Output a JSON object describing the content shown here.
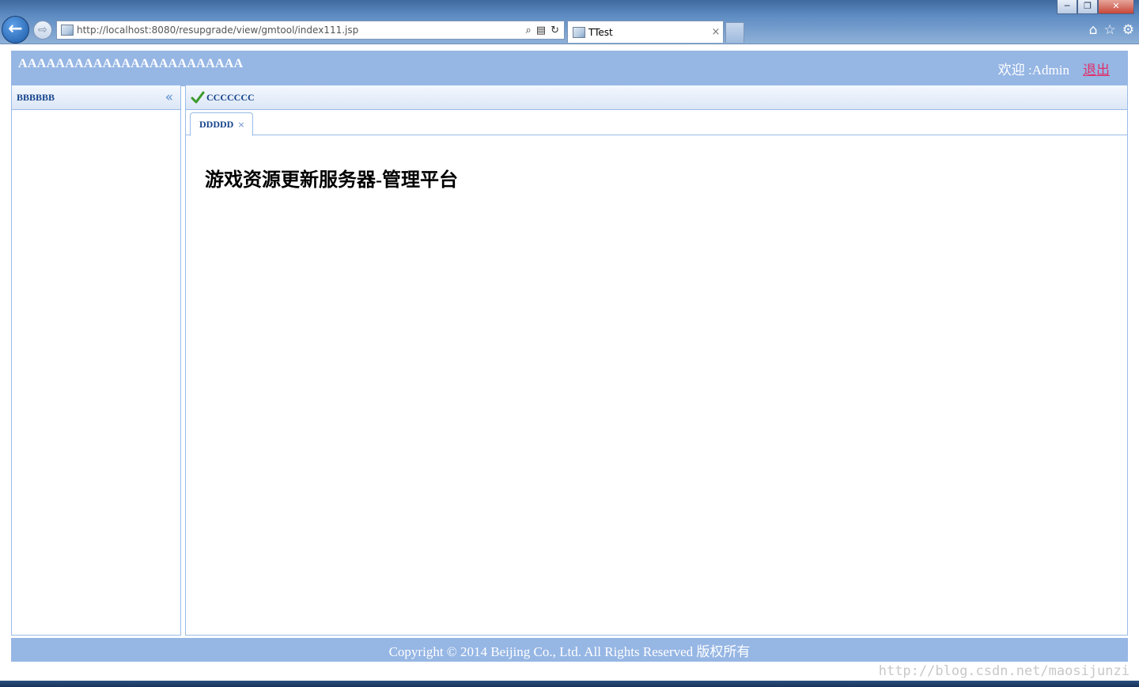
{
  "browser": {
    "url": "http://localhost:8080/resupgrade/view/gmtool/index111.jsp",
    "tab_title": "TTest",
    "tab_close": "×",
    "back_icon": "arrow-left-icon",
    "forward_icon": "arrow-right-icon",
    "window_buttons": {
      "minimize": "─",
      "restore": "❐",
      "close": "✕"
    },
    "address_tools": {
      "search": "⌕",
      "compat": "▤",
      "refresh": "↻"
    },
    "right_tools": {
      "home": "⌂",
      "favorites": "☆",
      "settings": "⚙"
    }
  },
  "header": {
    "title": "AAAAAAAAAAAAAAAAAAAAAAAA",
    "welcome": "欢迎 :Admin",
    "logout": "退出"
  },
  "left_panel": {
    "title": "BBBBBB",
    "collapse_glyph": "«"
  },
  "right_panel": {
    "title": "CCCCCCC",
    "tabs": [
      {
        "label": "DDDDD",
        "close": "×"
      }
    ],
    "heading": "游戏资源更新服务器-管理平台"
  },
  "footer": {
    "copyright": "Copyright © 2014 Beijing Co., Ltd. All Rights Reserved 版权所有"
  },
  "watermark": "http://blog.csdn.net/maosijunzi",
  "colors": {
    "header_bg": "#96b6e4",
    "panel_border": "#99bbe8",
    "panel_title": "#15428b",
    "logout_link": "#e0306a"
  }
}
